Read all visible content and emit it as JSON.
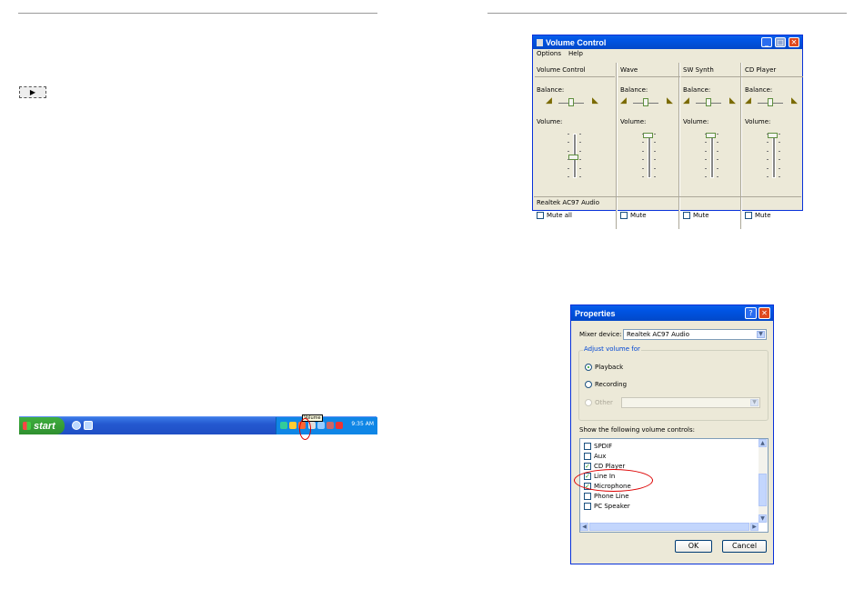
{
  "taskbar": {
    "start_label": "start",
    "tooltip": "Volume",
    "clock": "9:35 AM"
  },
  "volume_control": {
    "title": "Volume Control",
    "menu": [
      "Options",
      "Help"
    ],
    "columns": [
      {
        "header": "Volume Control",
        "balance_label": "Balance:",
        "volume_label": "Volume:",
        "mute_label": "Mute all",
        "volume_level": 0.45
      },
      {
        "header": "Wave",
        "balance_label": "Balance:",
        "volume_label": "Volume:",
        "mute_label": "Mute",
        "volume_level": 0.95
      },
      {
        "header": "SW Synth",
        "balance_label": "Balance:",
        "volume_label": "Volume:",
        "mute_label": "Mute",
        "volume_level": 0.95
      },
      {
        "header": "CD Player",
        "balance_label": "Balance:",
        "volume_label": "Volume:",
        "mute_label": "Mute",
        "volume_level": 0.95
      }
    ],
    "status": "Realtek AC97 Audio"
  },
  "properties": {
    "title": "Properties",
    "mixer_label": "Mixer device:",
    "mixer_value": "Realtek AC97 Audio",
    "adjust_label": "Adjust volume for",
    "radio_playback": "Playback",
    "radio_recording": "Recording",
    "radio_other": "Other",
    "show_label": "Show the following volume controls:",
    "controls": [
      {
        "label": "SPDIF",
        "checked": false
      },
      {
        "label": "Aux",
        "checked": false
      },
      {
        "label": "CD Player",
        "checked": true
      },
      {
        "label": "Line In",
        "checked": true
      },
      {
        "label": "Microphone",
        "checked": true
      },
      {
        "label": "Phone Line",
        "checked": false
      },
      {
        "label": "PC Speaker",
        "checked": false
      }
    ],
    "ok_label": "OK",
    "cancel_label": "Cancel"
  }
}
